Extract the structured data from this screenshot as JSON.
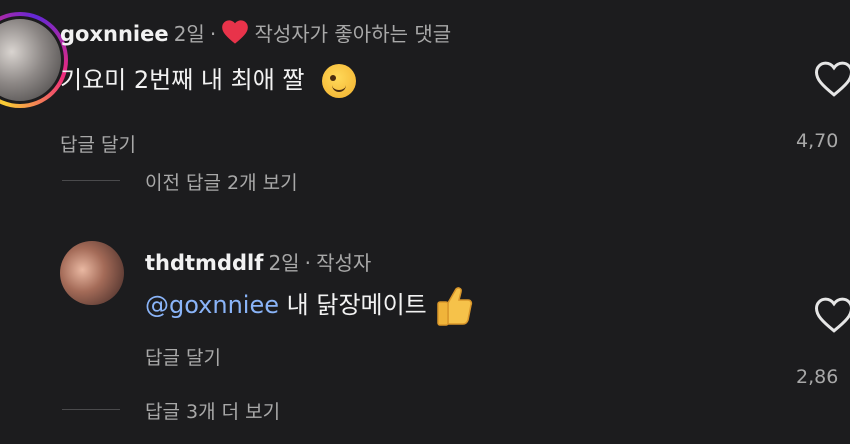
{
  "comment1": {
    "username": "goxnniee",
    "time": "2일",
    "separator": "·",
    "liked_by_author": "작성자가 좋아하는 댓글",
    "text": "기요미 2번째 내 최애 짤",
    "emoji": "winking-face",
    "reply_label": "답글 달기",
    "likes": "4,70",
    "view_previous": "이전 답글 2개 보기"
  },
  "reply1": {
    "username": "thdtmddlf",
    "time": "2일",
    "separator": "·",
    "author_badge": "작성자",
    "mention": "@goxnniee",
    "text": "내 닭장메이트",
    "emoji": "thumbs-up",
    "reply_label": "답글 달기",
    "likes": "2,86",
    "view_more": "답글 3개 더 보기"
  },
  "colors": {
    "background": "#1c1c1e",
    "mention": "#8ab4f8",
    "heart": "#e8334a",
    "muted": "#a8a8a8"
  }
}
